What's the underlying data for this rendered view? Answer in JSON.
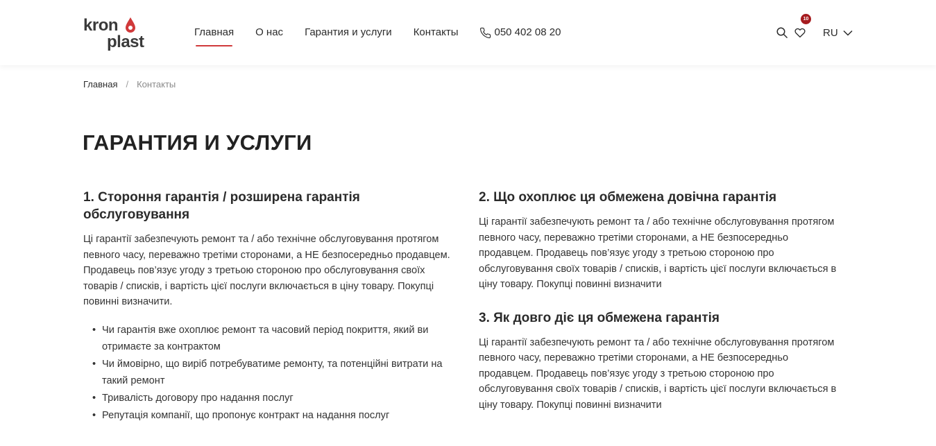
{
  "header": {
    "logo_text": "kronoplast",
    "nav": [
      {
        "label": "Главная",
        "active": true
      },
      {
        "label": "О нас",
        "active": false
      },
      {
        "label": "Гарантия и услуги",
        "active": false
      },
      {
        "label": "Контакты",
        "active": false
      }
    ],
    "phone": "050 402 08 20",
    "wishlist_count": "10",
    "language": "RU",
    "icons": {
      "search": "search-icon",
      "wishlist": "heart-icon",
      "phone": "phone-icon",
      "lang": "chevron-down-icon"
    }
  },
  "breadcrumb": {
    "home": "Главная",
    "separator": "/",
    "current": "Контакты"
  },
  "page_title": "ГАРАНТИЯ И УСЛУГИ",
  "sections": {
    "s1": {
      "title": "1. Стороння гарантія / розширена гарантія обслуговування",
      "body": "Ці гарантії забезпечують ремонт та / або технічне обслуговування протягом певного часу, переважно третіми сторонами, а НЕ безпосередньо продавцем. Продавець пов’язує угоду з третьою стороною про обслуговування своїх товарів / списків, і вартість цієї послуги включається в ціну товару. Покупці повинні визначити.",
      "bullets": [
        "Чи гарантія вже охоплює ремонт та часовий період покриття, який ви отримаєте за контрактом",
        "Чи ймовірно, що виріб потребуватиме ремонту, та потенційні витрати на такий ремонт",
        "Тривалість договору про надання послуг",
        "Репутація компанії, що пропонує контракт на надання послуг"
      ]
    },
    "s2": {
      "title": "2. Що охоплює ця обмежена довічна гарантія",
      "body": "Ці гарантії забезпечують ремонт та / або технічне обслуговування протягом певного часу, переважно третіми сторонами, а НЕ безпосередньо продавцем. Продавець пов’язує угоду з третьою стороною про обслуговування своїх товарів / списків, і вартість цієї послуги включається в ціну товару. Покупці повинні визначити"
    },
    "s3": {
      "title": "3. Як довго діє ця обмежена гарантія",
      "body": "Ці гарантії забезпечують ремонт та / або технічне обслуговування протягом певного часу, переважно третіми сторонами, а НЕ безпосередньо продавцем. Продавець пов’язує угоду з третьою стороною про обслуговування своїх товарів / списків, і вартість цієї послуги включається в ціну товару. Покупці повинні визначити"
    }
  },
  "colors": {
    "accent": "#d0393a",
    "badge": "#a61c1f",
    "text": "#2b2b2b",
    "muted": "#8a8a8a"
  }
}
